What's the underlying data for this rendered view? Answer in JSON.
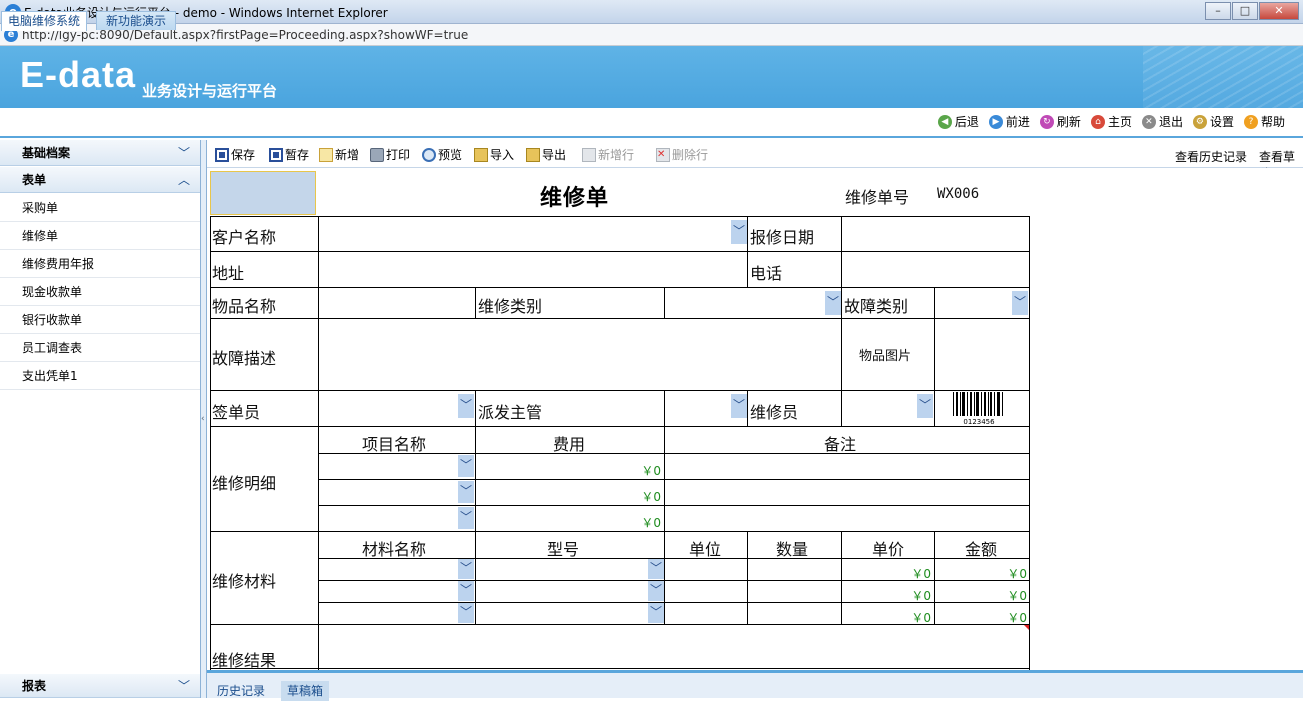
{
  "window": {
    "title": "E-data业务设计与运行平台 - demo - Windows Internet Explorer",
    "url": "http://lgy-pc:8090/Default.aspx?firstPage=Proceeding.aspx?showWF=true"
  },
  "banner": {
    "logo": "E-data",
    "subtitle": "业务设计与运行平台"
  },
  "top_tabs": [
    "电脑维修系统",
    "新功能演示"
  ],
  "nav": [
    {
      "label": "后退",
      "icon": "back-icon",
      "color": "#5aa64a"
    },
    {
      "label": "前进",
      "icon": "forward-icon",
      "color": "#3a8ad8"
    },
    {
      "label": "刷新",
      "icon": "refresh-icon",
      "color": "#c04ab6"
    },
    {
      "label": "主页",
      "icon": "home-icon",
      "color": "#d84a3a"
    },
    {
      "label": "退出",
      "icon": "exit-icon",
      "color": "#8a8a8a"
    },
    {
      "label": "设置",
      "icon": "settings-icon",
      "color": "#c9a23a"
    },
    {
      "label": "帮助",
      "icon": "help-icon",
      "color": "#f0a020"
    }
  ],
  "sidebar": {
    "sections": [
      {
        "title": "基础档案",
        "expanded": false
      },
      {
        "title": "表单",
        "expanded": true
      },
      {
        "title": "报表",
        "expanded": false
      }
    ],
    "items": [
      "采购单",
      "维修单",
      "维修费用年报",
      "现金收款单",
      "银行收款单",
      "员工调查表",
      "支出凭单1"
    ]
  },
  "toolbar": {
    "buttons": [
      {
        "label": "保存",
        "icon": "save-icon",
        "enabled": true
      },
      {
        "label": "暂存",
        "icon": "temp-save-icon",
        "enabled": true
      },
      {
        "label": "新增",
        "icon": "new-icon",
        "enabled": true
      },
      {
        "label": "打印",
        "icon": "print-icon",
        "enabled": true
      },
      {
        "label": "预览",
        "icon": "preview-icon",
        "enabled": true
      },
      {
        "label": "导入",
        "icon": "import-icon",
        "enabled": true
      },
      {
        "label": "导出",
        "icon": "export-icon",
        "enabled": true
      },
      {
        "label": "新增行",
        "icon": "add-row-icon",
        "enabled": false
      },
      {
        "label": "删除行",
        "icon": "delete-row-icon",
        "enabled": false
      }
    ],
    "right_links": [
      "查看历史记录",
      "查看草稿"
    ]
  },
  "form": {
    "title": "维修单",
    "order_no_label": "维修单号",
    "order_no": "WX006",
    "labels": {
      "customer": "客户名称",
      "report_date": "报修日期",
      "address": "地址",
      "phone": "电话",
      "item_name": "物品名称",
      "repair_type": "维修类别",
      "fault_type": "故障类别",
      "fault_desc": "故障描述",
      "item_image": "物品图片",
      "signer": "签单员",
      "dispatcher": "派发主管",
      "repairer": "维修员",
      "detail": "维修明细",
      "materials": "维修材料",
      "result": "维修结果"
    },
    "detail_columns": [
      "项目名称",
      "费用",
      "备注"
    ],
    "detail_rows": [
      {
        "fee": "￥0"
      },
      {
        "fee": "￥0"
      },
      {
        "fee": "￥0"
      }
    ],
    "material_columns": [
      "材料名称",
      "型号",
      "单位",
      "数量",
      "单价",
      "金额"
    ],
    "material_rows": [
      {
        "price": "￥0",
        "amount": "￥0"
      },
      {
        "price": "￥0",
        "amount": "￥0"
      },
      {
        "price": "￥0",
        "amount": "￥0"
      }
    ],
    "barcode_text": "0123456"
  },
  "bottom_tabs": [
    "历史记录",
    "草稿箱"
  ]
}
